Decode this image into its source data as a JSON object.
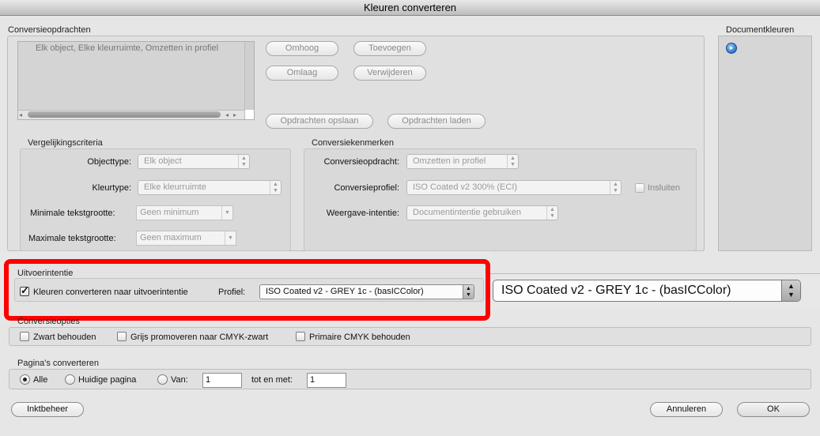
{
  "window": {
    "title": "Kleuren converteren"
  },
  "conversion_commands": {
    "label": "Conversieopdrachten",
    "list_items": [
      "Elk object, Elke kleurruimte, Omzetten in profiel"
    ],
    "buttons": {
      "up": "Omhoog",
      "add": "Toevoegen",
      "down": "Omlaag",
      "remove": "Verwijderen",
      "save": "Opdrachten opslaan",
      "load": "Opdrachten laden"
    }
  },
  "document_colors": {
    "label": "Documentkleuren"
  },
  "matching_criteria": {
    "label": "Vergelijkingscriteria",
    "object_type": {
      "label": "Objecttype:",
      "value": "Elk object"
    },
    "color_type": {
      "label": "Kleurtype:",
      "value": "Elke kleurruimte"
    },
    "min_text_size": {
      "label": "Minimale tekstgrootte:",
      "value": "Geen minimum"
    },
    "max_text_size": {
      "label": "Maximale tekstgrootte:",
      "value": "Geen maximum"
    }
  },
  "conversion_attributes": {
    "label": "Conversiekenmerken",
    "command": {
      "label": "Conversieopdracht:",
      "value": "Omzetten in profiel"
    },
    "profile": {
      "label": "Conversieprofiel:",
      "value": "ISO Coated v2 300% (ECI)"
    },
    "embed": {
      "label": "Insluiten",
      "checked": false
    },
    "rendering_intent": {
      "label": "Weergave-intentie:",
      "value": "Documentintentie gebruiken"
    }
  },
  "output_intent": {
    "label": "Uitvoerintentie",
    "checkbox_label": "Kleuren converteren naar uitvoerintentie",
    "checked": true,
    "profile_label": "Profiel:",
    "profile_value": "ISO Coated v2 - GREY 1c - (basICColor)",
    "zoomed_profile_value": "ISO Coated v2 - GREY 1c - (basICColor)",
    "highlight_color": "#ff0000"
  },
  "conversion_options": {
    "label": "Conversieopties",
    "keep_black": {
      "label": "Zwart behouden",
      "checked": false
    },
    "promote_grays": {
      "label": "Grijs promoveren naar CMYK-zwart",
      "checked": false
    },
    "keep_primary": {
      "label": "Primaire CMYK behouden",
      "checked": false
    }
  },
  "page_convert": {
    "label": "Pagina's converteren",
    "all": {
      "label": "Alle",
      "selected": true
    },
    "current": {
      "label": "Huidige pagina",
      "selected": false
    },
    "from": {
      "label": "Van:",
      "value": "1"
    },
    "to": {
      "label": "tot en met:",
      "value": "1"
    }
  },
  "footer": {
    "ink_manager": "Inktbeheer",
    "cancel": "Annuleren",
    "ok": "OK"
  }
}
